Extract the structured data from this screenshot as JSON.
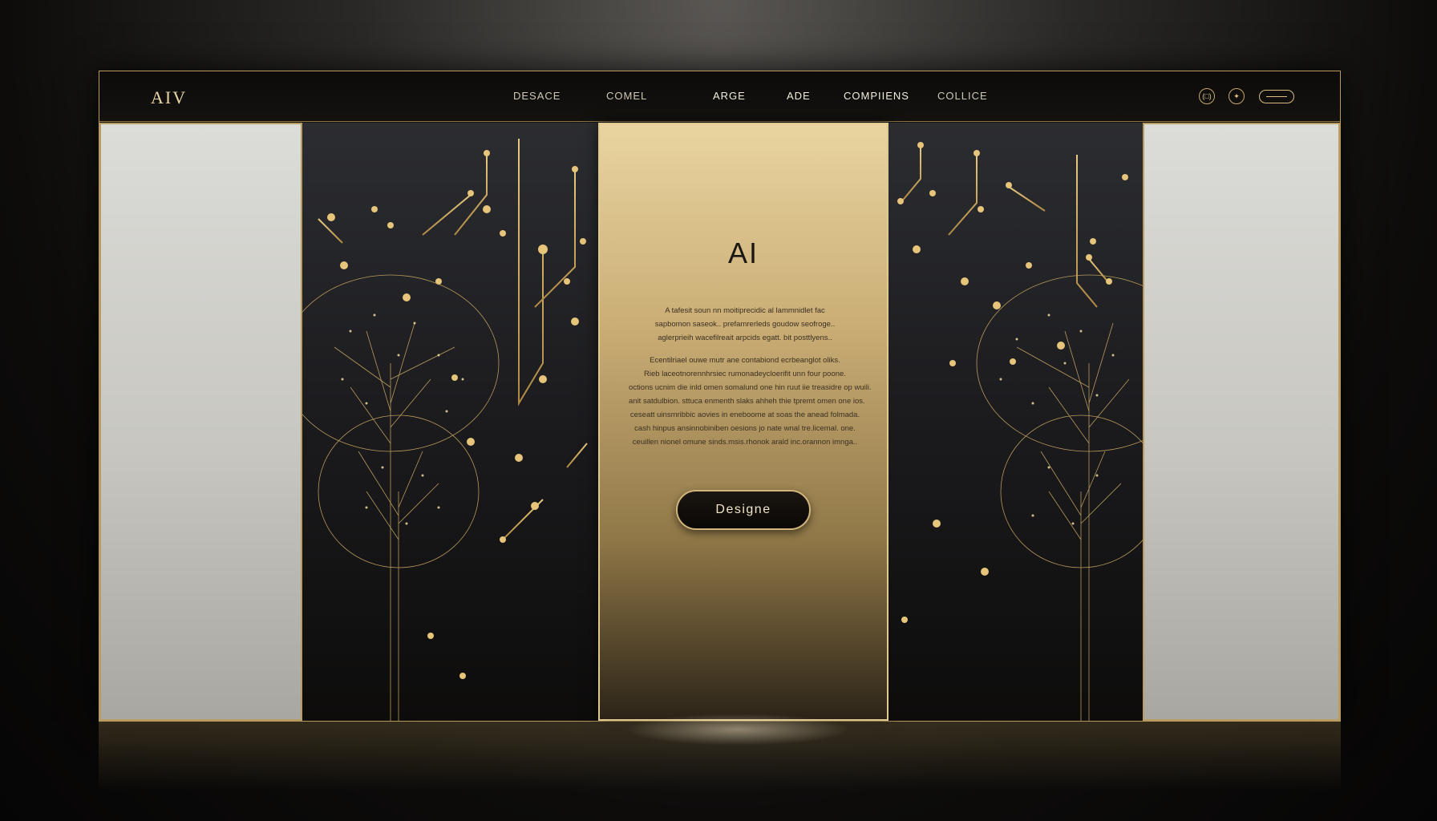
{
  "header": {
    "logo": "AIV",
    "nav": [
      "DESACE",
      "COMEL",
      "ARGE",
      "ADE",
      "COMPIIENS",
      "COLLICE"
    ],
    "icons": [
      "user-icon",
      "settings-icon"
    ],
    "icon_user_glyph": "(□)",
    "icon_settings_glyph": "✦",
    "menu_pill": "menu-pill"
  },
  "hero": {
    "title": "AI",
    "paragraph1": [
      "A tafesit soun nn moitiprecidic al lammnidlet fac",
      "sapbomon saseok.. prefamrerleds goudow seofroge..",
      "aglerprieih wacefilreait arpcids egatt. bit posttlyens.."
    ],
    "paragraph2": [
      "Ecentilriael ouwe mutr ane contabiond ecrbeanglot oliks.",
      "Rieb laceotnorennhrsiec rumonadeycloerifit unn four poone.",
      "octions ucnim die inld omen somalund one hin ruut iie treasidre op wuili.",
      "anit satdulbion. sttuca enmenth slaks ahheh thie tpremt omen one ios.",
      "ceseatt uinsmribbic aovies in eneboome at soas the anead folmada.",
      "cash hinpus ansinnobiniben oesions jo nate wnal tre.licemal. one.",
      "ceuillen nionel omune sinds.msis.rhonok arald inc.orannon imnga.."
    ],
    "cta": "Designe"
  },
  "colors": {
    "gold": "#d4b676",
    "dark": "#141210",
    "accent": "#e9d4a0"
  }
}
